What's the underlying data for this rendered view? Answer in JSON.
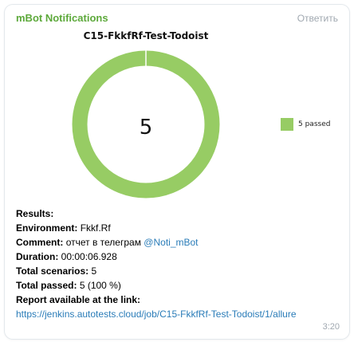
{
  "message": {
    "sender": "mBot Notifications",
    "reply_label": "Ответить",
    "time": "3:20"
  },
  "chart_data": {
    "type": "pie",
    "title": "C15-FkkfRf-Test-Todoist",
    "center_label": "5",
    "categories": [
      "5 passed"
    ],
    "values": [
      5
    ],
    "colors": [
      "#97cc64"
    ],
    "legend_position": "right"
  },
  "report": {
    "results_label": "Results:",
    "environment_label": "Environment:",
    "environment_value": "Fkkf.Rf",
    "comment_label": "Comment:",
    "comment_value": "отчет в телеграм",
    "comment_mention": "@Noti_mBot",
    "duration_label": "Duration:",
    "duration_value": "00:00:06.928",
    "total_scenarios_label": "Total scenarios:",
    "total_scenarios_value": "5",
    "total_passed_label": "Total passed:",
    "total_passed_value": "5 (100 %)",
    "report_link_label": "Report available at the link:",
    "report_link": "https://jenkins.autotests.cloud/job/C15-FkkfRf-Test-Todoist/1/allure"
  }
}
